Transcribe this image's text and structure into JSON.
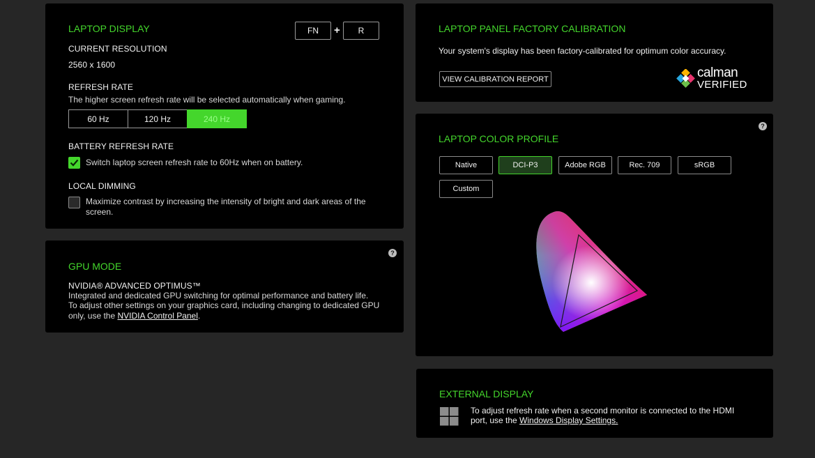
{
  "laptop_display": {
    "title": "LAPTOP DISPLAY",
    "shortcut": {
      "key1": "FN",
      "plus": "+",
      "key2": "R"
    },
    "current_resolution_label": "CURRENT RESOLUTION",
    "current_resolution_value": "2560 x 1600",
    "refresh_rate_label": "REFRESH RATE",
    "refresh_rate_desc": "The higher screen refresh rate will be selected automatically when gaming.",
    "refresh_options": [
      "60 Hz",
      "120 Hz",
      "240 Hz"
    ],
    "refresh_selected": "240 Hz",
    "battery_label": "BATTERY REFRESH RATE",
    "battery_checkbox_text": "Switch laptop screen refresh rate to 60Hz when on battery.",
    "battery_checked": true,
    "local_dimming_label": "LOCAL DIMMING",
    "local_dimming_text": "Maximize contrast by increasing the intensity of bright and dark areas of the screen.",
    "local_dimming_checked": false
  },
  "gpu_mode": {
    "title": "GPU MODE",
    "mode_name": "NVIDIA® ADVANCED OPTIMUS™",
    "desc_line1": "Integrated and dedicated GPU switching for optimal performance and battery life.",
    "desc_line2": "To adjust other settings on your graphics card, including changing to dedicated GPU",
    "desc_line3_prefix": "only, use the ",
    "desc_link": "NVIDIA Control Panel",
    "desc_line3_suffix": ".",
    "help": "?"
  },
  "calibration": {
    "title": "LAPTOP PANEL FACTORY CALIBRATION",
    "desc": "Your system's display has been factory-calibrated for optimum color accuracy.",
    "report_button": "VIEW CALIBRATION REPORT",
    "logo_line1": "calman",
    "logo_line2": "VERIFIED"
  },
  "color_profile": {
    "title": "LAPTOP COLOR PROFILE",
    "help": "?",
    "profiles": [
      "Native",
      "DCI-P3",
      "Adobe RGB",
      "Rec. 709",
      "sRGB",
      "Custom"
    ],
    "selected": "DCI-P3"
  },
  "external_display": {
    "title": "EXTERNAL DISPLAY",
    "desc_line1": "To adjust refresh rate when a second monitor is connected to the HDMI",
    "desc_line2_prefix": "port, use the ",
    "desc_link": "Windows Display Settings.",
    "icon": "windows-icon"
  },
  "colors": {
    "accent": "#44d62c",
    "card": "#000000",
    "background": "#262626"
  }
}
